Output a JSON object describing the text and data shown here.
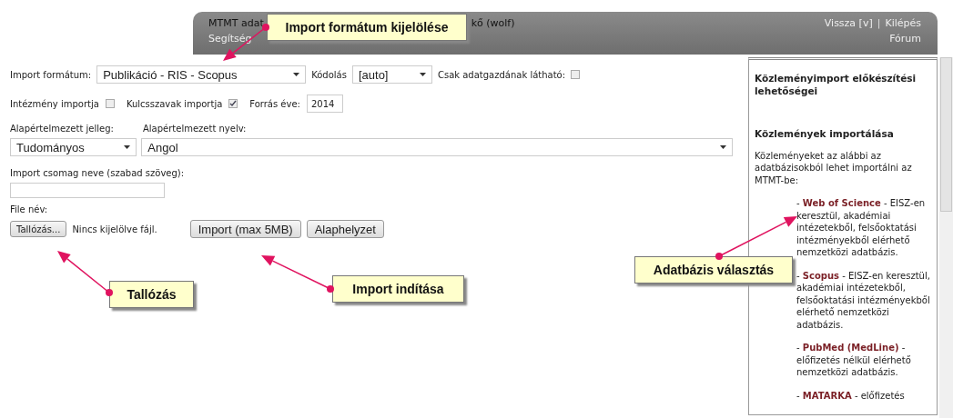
{
  "header": {
    "title_left": "MTMT adat",
    "title_right": "kő (wolf)",
    "nav": [
      "Segítség"
    ],
    "links_right": [
      {
        "label": "Vissza [v]"
      },
      {
        "label": "Kilépés"
      }
    ],
    "separator": "|",
    "forum": "Fórum"
  },
  "form": {
    "format": {
      "label": "Import formátum:",
      "value": "Publikáció - RIS - Scopus"
    },
    "encoding": {
      "label": "Kódolás",
      "value": "[auto]"
    },
    "owner_only": {
      "label": "Csak adatgazdának látható:",
      "checked": false
    },
    "institution": {
      "label": "Intézmény importja",
      "checked": false
    },
    "keywords": {
      "label": "Kulcsszavak importja",
      "checked": true
    },
    "year": {
      "label": "Forrás éve:",
      "value": "2014"
    },
    "type": {
      "label": "Alapértelmezett jelleg:",
      "value": "Tudományos"
    },
    "language": {
      "label": "Alapértelmezett nyelv:",
      "value": "Angol"
    },
    "package": {
      "label": "Import csomag neve (szabad szöveg):"
    },
    "file": {
      "label": "File név:",
      "browse": "Tallózás...",
      "status": "Nincs kijelölve fájl."
    },
    "buttons": [
      "Import (max 5MB)",
      "Alaphelyzet"
    ]
  },
  "sidebar": {
    "title": "Közleményimport előkészítési lehetőségei",
    "heading": "Közlemények importálása",
    "intro": "Közleményeket az alábbi az adatbázisokból lehet importálni az MTMT-be:",
    "databases": [
      {
        "lead": "-",
        "name": "Web of Science",
        "description": "- EISZ-en keresztül, akadémiai intézetekből, felsőoktatási intézményekből elérhető nemzetközi adatbázis."
      },
      {
        "lead": "-",
        "name": "Scopus",
        "description": "- EISZ-en keresztül, akadémiai intézetekből, felsőoktatási intézményekből elérhető nemzetközi adatbázis."
      },
      {
        "lead": "-",
        "name": "PubMed (MedLine)",
        "description": "- előfizetés nélkül elérhető nemzetközi adatbázis."
      },
      {
        "lead": "-",
        "name": "MATARKA",
        "description": "- előfizetés"
      }
    ]
  },
  "callouts": [
    {
      "text": "Import formátum kijelölése"
    },
    {
      "text": "Tallózás"
    },
    {
      "text": "Import indítása"
    },
    {
      "text": "Adatbázis választás"
    }
  ]
}
